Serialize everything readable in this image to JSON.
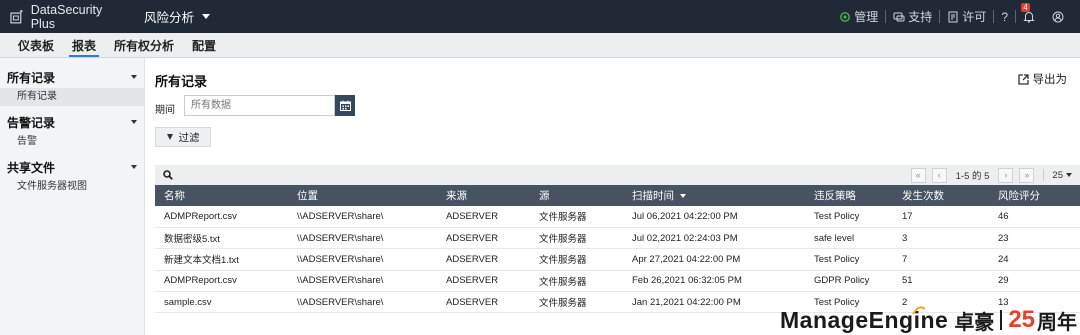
{
  "header": {
    "brand": "DataSecurity Plus",
    "module": "风险分析",
    "actions": [
      {
        "label": "管理",
        "icon": "gear-icon"
      },
      {
        "label": "支持",
        "icon": "chat-icon"
      },
      {
        "label": "许可",
        "icon": "license-icon"
      }
    ],
    "help": "?",
    "notification_count": "4"
  },
  "nav": {
    "tabs": [
      "仪表板",
      "报表",
      "所有权分析",
      "配置"
    ],
    "active": "报表"
  },
  "sidebar": {
    "groups": [
      {
        "label": "所有记录",
        "items": [
          "所有记录"
        ]
      },
      {
        "label": "告警记录",
        "items": [
          "告警"
        ]
      },
      {
        "label": "共享文件",
        "items": [
          "文件服务器视图"
        ]
      }
    ]
  },
  "main": {
    "title": "所有记录",
    "export": "导出为",
    "period_label": "期间",
    "period_placeholder": "所有数据",
    "filter": "过滤",
    "pager": {
      "info": "1-5 的 5",
      "page_size": "25"
    },
    "columns": [
      "名称",
      "位置",
      "来源",
      "源",
      "扫描时间",
      "违反策略",
      "发生次数",
      "风险评分"
    ],
    "rows": [
      [
        "ADMPReport.csv",
        "\\\\ADSERVER\\share\\",
        "ADSERVER",
        "文件服务器",
        "Jul 06,2021 04:22:00 PM",
        "Test Policy",
        "17",
        "46"
      ],
      [
        "数据密级5.txt",
        "\\\\ADSERVER\\share\\",
        "ADSERVER",
        "文件服务器",
        "Jul 02,2021 02:24:03 PM",
        "safe level",
        "3",
        "23"
      ],
      [
        "新建文本文档1.txt",
        "\\\\ADSERVER\\share\\",
        "ADSERVER",
        "文件服务器",
        "Apr 27,2021 04:22:00 PM",
        "Test Policy",
        "7",
        "24"
      ],
      [
        "ADMPReport.csv",
        "\\\\ADSERVER\\share\\",
        "ADSERVER",
        "文件服务器",
        "Feb 26,2021 06:32:05 PM",
        "GDPR Policy",
        "51",
        "29"
      ],
      [
        "sample.csv",
        "\\\\ADSERVER\\share\\",
        "ADSERVER",
        "文件服务器",
        "Jan 21,2021 04:22:00 PM",
        "Test Policy",
        "2",
        "13"
      ]
    ]
  },
  "watermark": {
    "brand": "ManageEngine",
    "cn": "卓豪",
    "years": "25",
    "suffix": "周年"
  }
}
